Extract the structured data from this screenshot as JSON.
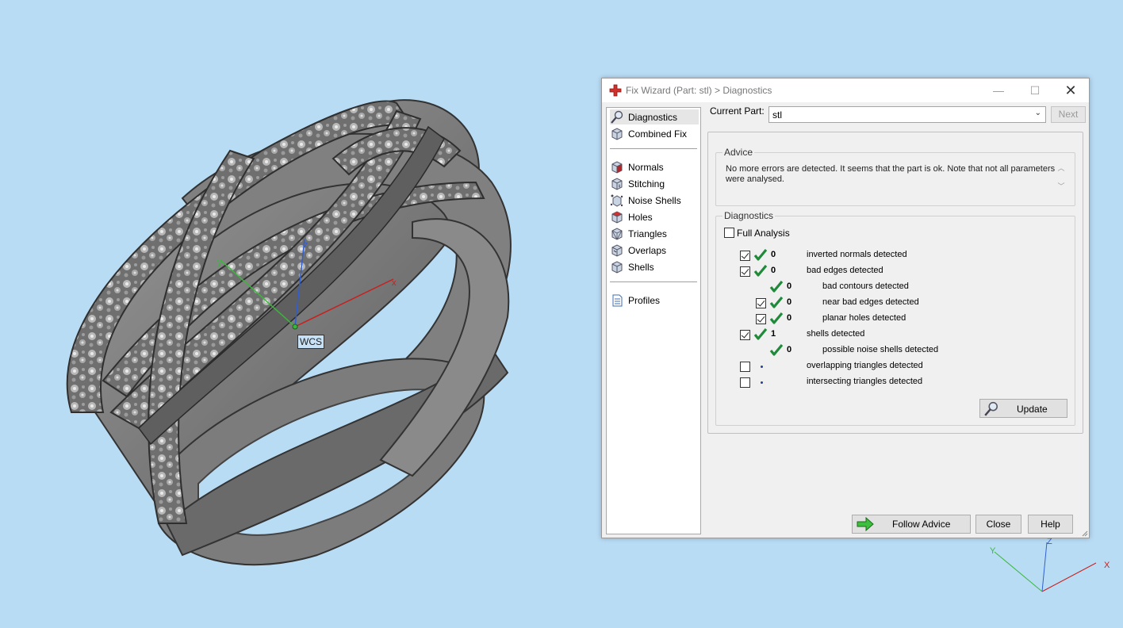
{
  "viewport": {
    "wcs_label": "WCS",
    "axis_x": "x",
    "axis_y": "y",
    "axis_z": "z",
    "corner_axis_x": "X",
    "corner_axis_y": "Y",
    "corner_axis_z": "Z"
  },
  "dialog": {
    "title": "Fix Wizard (Part: stl) > Diagnostics",
    "window_controls": {
      "minimize": "—",
      "maximize": "☐",
      "close": "✕"
    },
    "nav": {
      "top": [
        {
          "label": "Diagnostics",
          "icon": "magnifier-icon",
          "selected": true
        },
        {
          "label": "Combined Fix",
          "icon": "cube-icon"
        }
      ],
      "fixes": [
        {
          "label": "Normals",
          "icon": "normals-cube-icon"
        },
        {
          "label": "Stitching",
          "icon": "stitching-cube-icon"
        },
        {
          "label": "Noise Shells",
          "icon": "noise-shells-icon"
        },
        {
          "label": "Holes",
          "icon": "holes-cube-icon"
        },
        {
          "label": "Triangles",
          "icon": "triangles-cube-icon"
        },
        {
          "label": "Overlaps",
          "icon": "overlaps-cube-icon"
        },
        {
          "label": "Shells",
          "icon": "shells-cube-icon"
        }
      ],
      "bottom": [
        {
          "label": "Profiles",
          "icon": "document-icon"
        }
      ]
    },
    "current_part": {
      "label": "Current Part:",
      "value": "stl",
      "next": "Next"
    },
    "advice": {
      "title": "Advice",
      "text": "No more errors are detected. It seems that the part is ok. Note that not all parameters were analysed."
    },
    "diagnostics": {
      "title": "Diagnostics",
      "full_analysis": {
        "label": "Full Analysis",
        "checked": false
      },
      "rows": [
        {
          "checkbox": true,
          "checked": true,
          "status": "ok",
          "count": "0",
          "desc": "inverted normals detected",
          "indent": 0
        },
        {
          "checkbox": true,
          "checked": true,
          "status": "ok",
          "count": "0",
          "desc": "bad edges detected",
          "indent": 0
        },
        {
          "checkbox": false,
          "checked": false,
          "status": "ok",
          "count": "0",
          "desc": "bad contours detected",
          "indent": 1
        },
        {
          "checkbox": true,
          "checked": true,
          "status": "ok",
          "count": "0",
          "desc": "near bad edges detected",
          "indent": 1
        },
        {
          "checkbox": true,
          "checked": true,
          "status": "ok",
          "count": "0",
          "desc": "planar holes detected",
          "indent": 1
        },
        {
          "checkbox": true,
          "checked": true,
          "status": "ok",
          "count": "1",
          "desc": "shells detected",
          "indent": 0
        },
        {
          "checkbox": false,
          "checked": false,
          "status": "ok",
          "count": "0",
          "desc": "possible noise shells detected",
          "indent": 1
        },
        {
          "checkbox": true,
          "checked": false,
          "status": "pending",
          "count": "",
          "desc": "overlapping triangles detected",
          "indent": 0
        },
        {
          "checkbox": true,
          "checked": false,
          "status": "pending",
          "count": "",
          "desc": "intersecting triangles detected",
          "indent": 0
        }
      ],
      "update": "Update"
    },
    "buttons": {
      "follow_advice": "Follow Advice",
      "close": "Close",
      "help": "Help"
    }
  },
  "colors": {
    "background": "#b9dcf5",
    "model_gray": "#7a7a7a",
    "check_green": "#1e8a3a",
    "title_icon_red": "#d0312d",
    "arrow_green": "#3cbf3c"
  }
}
